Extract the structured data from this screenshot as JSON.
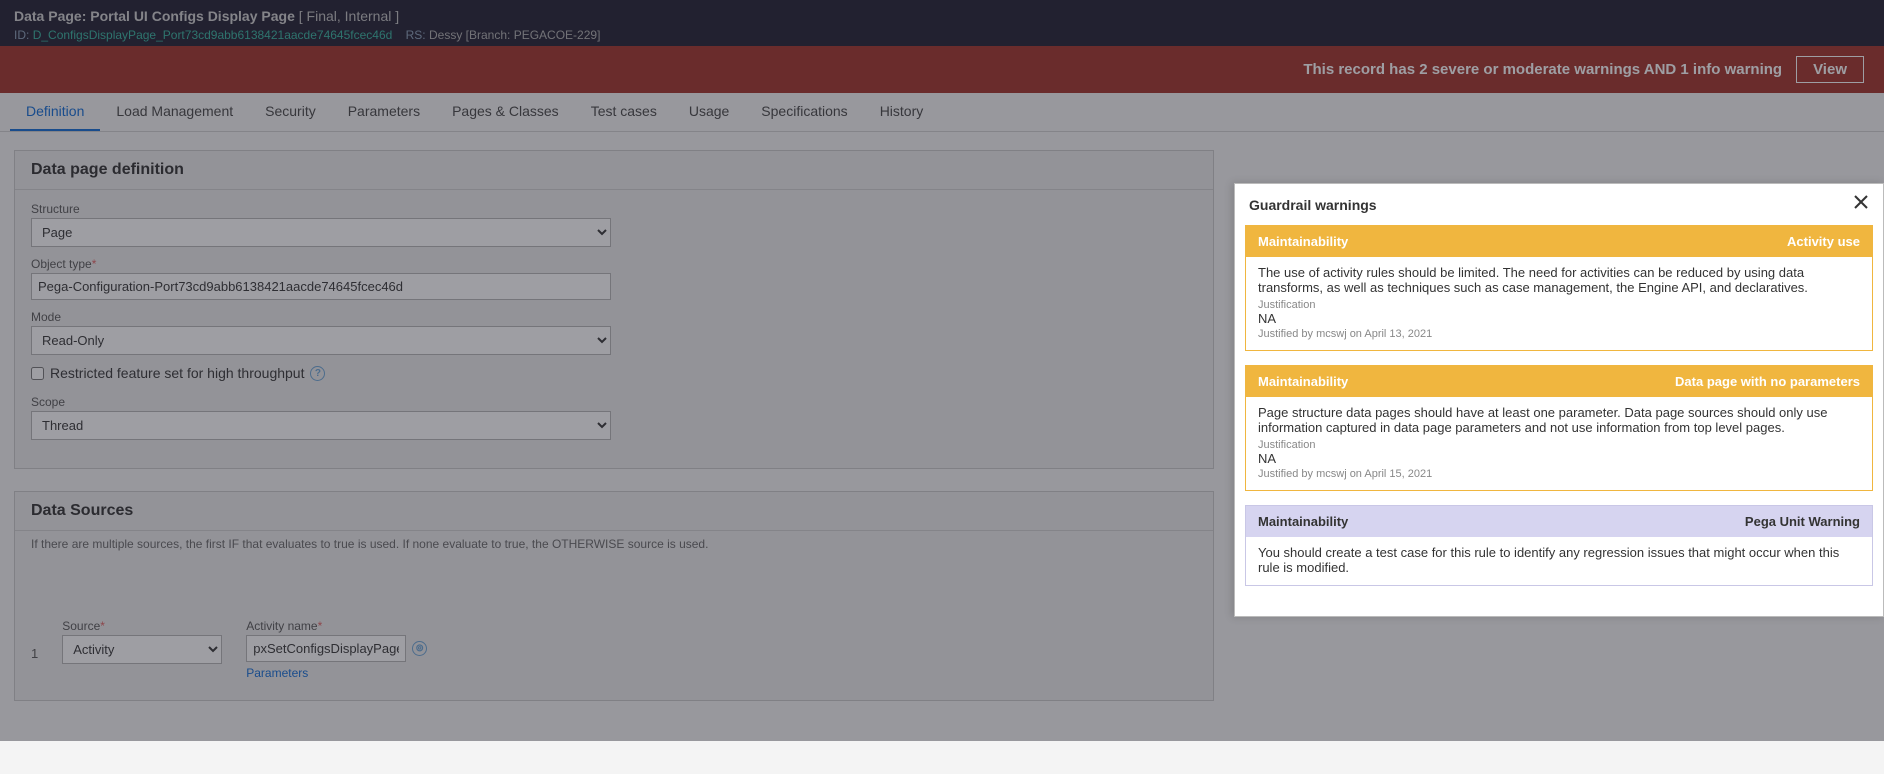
{
  "header": {
    "labelPrefix": "Data Page:",
    "title": "Portal UI Configs Display Page",
    "status": "[ Final, Internal ]",
    "idLabel": "ID:",
    "idValue": "D_ConfigsDisplayPage_Port73cd9abb6138421aacde74645fcec46d",
    "rsLabel": "RS:",
    "rsValue": "Dessy [Branch: PEGACOE-229]"
  },
  "warning": {
    "text": "This record has 2 severe or moderate warnings AND 1 info warning",
    "viewLabel": "View"
  },
  "tabs": [
    "Definition",
    "Load Management",
    "Security",
    "Parameters",
    "Pages & Classes",
    "Test cases",
    "Usage",
    "Specifications",
    "History"
  ],
  "activeTab": 0,
  "defPanel": {
    "title": "Data page definition",
    "structureLabel": "Structure",
    "structureValue": "Page",
    "objectTypeLabel": "Object type",
    "objectTypeValue": "Pega-Configuration-Port73cd9abb6138421aacde74645fcec46d",
    "modeLabel": "Mode",
    "modeValue": "Read-Only",
    "restrictedLabel": "Restricted feature set for high throughput",
    "scopeLabel": "Scope",
    "scopeValue": "Thread"
  },
  "sourcesPanel": {
    "title": "Data Sources",
    "hint": "If there are multiple sources, the first IF that evaluates to true is used. If none evaluate to true, the OTHERWISE source is used.",
    "row": {
      "num": "1",
      "sourceLabel": "Source",
      "sourceValue": "Activity",
      "activityNameLabel": "Activity name",
      "activityNameValue": "pxSetConfigsDisplayPage",
      "paramsLink": "Parameters"
    }
  },
  "guardrail": {
    "title": "Guardrail warnings",
    "cards": [
      {
        "sev": "moderate",
        "cat": "Maintainability",
        "tag": "Activity use",
        "msg": "The use of activity rules should be limited. The need for activities can be reduced by using data transforms, as well as techniques such as case management, the Engine API, and declaratives.",
        "jLabel": "Justification",
        "jVal": "NA",
        "jBy": "Justified by mcswj on April 13, 2021"
      },
      {
        "sev": "moderate",
        "cat": "Maintainability",
        "tag": "Data page with no parameters",
        "msg": "Page structure data pages should have at least one parameter. Data page sources should only use information captured in data page parameters and not use information from top level pages.",
        "jLabel": "Justification",
        "jVal": "NA",
        "jBy": "Justified by mcswj on April 15, 2021"
      },
      {
        "sev": "info",
        "cat": "Maintainability",
        "tag": "Pega Unit Warning",
        "msg": "You should create a test case for this rule to identify any regression issues that might occur when this rule is modified."
      }
    ]
  }
}
